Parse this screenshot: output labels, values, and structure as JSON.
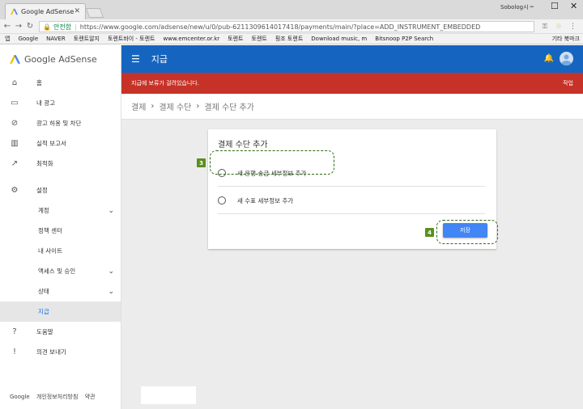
{
  "browser": {
    "tab_title": "Google AdSense",
    "window_user": "Sobolog시",
    "secure_label": "안전함",
    "url": "https://www.google.com/adsense/new/u/0/pub-6211309614017418/payments/main/?place=ADD_INSTRUMENT_EMBEDDED",
    "bookmarks": [
      "앱",
      "Google",
      "NAVER",
      "토렌트알지",
      "토렌트바이 - 토렌트",
      "www.emcenter.or.kr",
      "토렌트",
      "토렌트",
      "핑조 토렌트",
      "Download music, m",
      "Bitsnoop P2P Search"
    ],
    "other_bookmarks": "기타 북마크"
  },
  "sidebar": {
    "logo": "Google AdSense",
    "items": [
      {
        "label": "홈",
        "icon": "home-icon"
      },
      {
        "label": "내 광고",
        "icon": "ads-icon"
      },
      {
        "label": "광고 허용 및 차단",
        "icon": "block-icon"
      },
      {
        "label": "실적 보고서",
        "icon": "report-icon"
      },
      {
        "label": "최적화",
        "icon": "trending-icon"
      },
      {
        "label": "설정",
        "icon": "gear-icon"
      },
      {
        "label": "계정"
      },
      {
        "label": "정책 센터"
      },
      {
        "label": "내 사이트"
      },
      {
        "label": "액세스 및 승인"
      },
      {
        "label": "상태"
      },
      {
        "label": "지급"
      },
      {
        "label": "도움말",
        "icon": "help-icon"
      },
      {
        "label": "의견 보내기",
        "icon": "feedback-icon"
      }
    ],
    "footer": [
      "Google",
      "개인정보처리방침",
      "약관"
    ]
  },
  "header": {
    "title": "지급"
  },
  "alert": {
    "message": "지급에 보류가 걸려있습니다.",
    "action": "작업"
  },
  "breadcrumb": [
    "결제",
    "결제 수단",
    "결제 수단 추가"
  ],
  "card": {
    "title": "결제 수단 추가",
    "options": [
      "새 은행 송금 세부정보 추가",
      "새 수표 세부정보 추가"
    ],
    "save_label": "저장"
  },
  "annotations": {
    "badge_1": "3",
    "badge_2": "4"
  }
}
